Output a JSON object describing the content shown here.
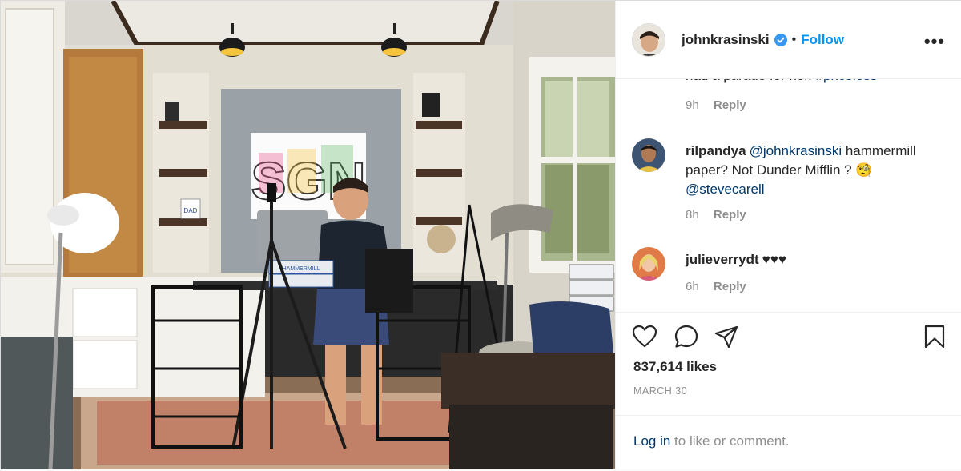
{
  "post": {
    "photo_alt": "",
    "header": {
      "username": "johnkrasinski",
      "verified": true,
      "separator": "•",
      "follow_label": "Follow",
      "more_label": "•••"
    },
    "comments": [
      {
        "partial_text": "had a parade for her. ",
        "partial_tag": "#priceless",
        "time": "9h",
        "reply_label": "Reply"
      },
      {
        "username": "rilpandya",
        "mention1": "@johnkrasinski",
        "text": " hammermill paper? Not Dunder Mifflin ? ",
        "emoji": "🧐",
        "mention2": "@stevecarell",
        "time": "8h",
        "reply_label": "Reply"
      },
      {
        "username": "julieverrydt",
        "text": "♥♥♥",
        "time": "6h",
        "reply_label": "Reply"
      }
    ],
    "actions": {
      "like_icon": "heart-icon",
      "comment_icon": "comment-icon",
      "share_icon": "share-icon",
      "save_icon": "bookmark-icon"
    },
    "likes": "837,614 likes",
    "date": "MARCH 30",
    "login": {
      "link": "Log in",
      "rest": " to like or comment."
    },
    "photo_text": {
      "art": "SGN",
      "box_label": "HAMMERMILL",
      "mug_label": "DAD"
    }
  },
  "colors": {
    "accent": "#0095f6",
    "link": "#00376b",
    "muted": "#8e8e8e",
    "text": "#262626",
    "verified": "#3897f0"
  }
}
